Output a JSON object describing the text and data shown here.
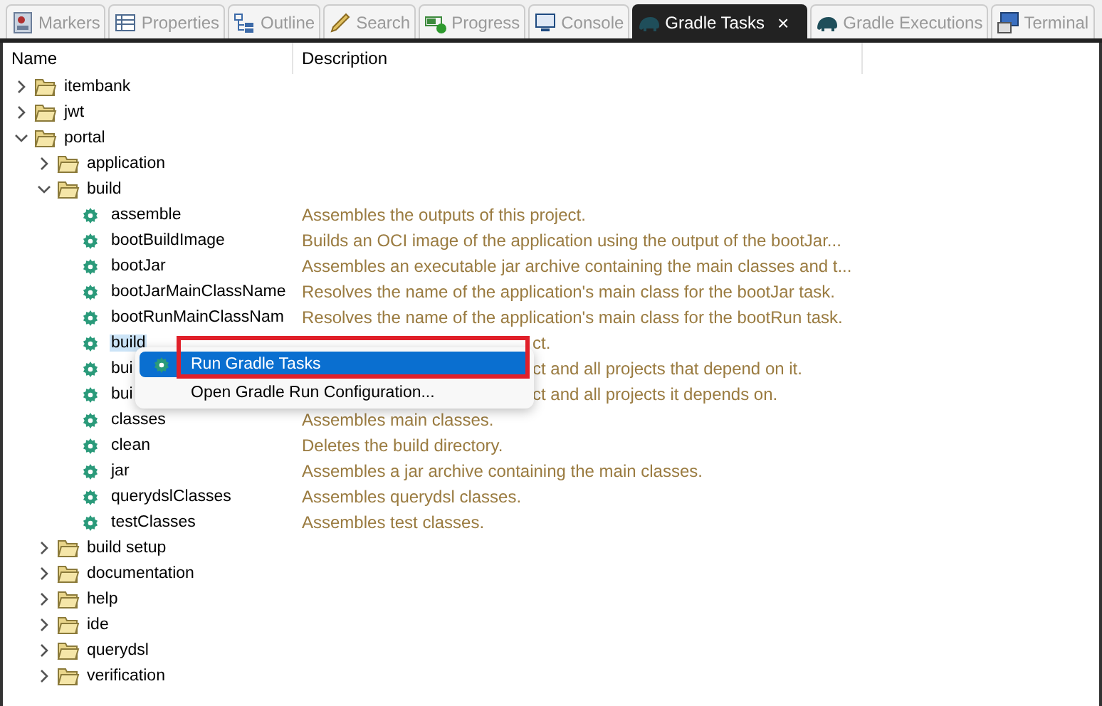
{
  "tabs": [
    {
      "label": "Markers",
      "selected": false
    },
    {
      "label": "Properties",
      "selected": false
    },
    {
      "label": "Outline",
      "selected": false
    },
    {
      "label": "Search",
      "selected": false
    },
    {
      "label": "Progress",
      "selected": false
    },
    {
      "label": "Console",
      "selected": false
    },
    {
      "label": "Gradle Tasks",
      "selected": true,
      "close": "×"
    },
    {
      "label": "Gradle Executions",
      "selected": false
    },
    {
      "label": "Terminal",
      "selected": false
    }
  ],
  "table": {
    "columns": [
      "Name",
      "Description"
    ],
    "rows": [
      {
        "kind": "folder",
        "name": "itembank",
        "expanded": false
      },
      {
        "kind": "folder",
        "name": "jwt",
        "expanded": false
      },
      {
        "kind": "folder",
        "name": "portal",
        "expanded": true,
        "children": [
          {
            "kind": "folder",
            "name": "application",
            "expanded": false
          },
          {
            "kind": "folder",
            "name": "build",
            "expanded": true,
            "children": [
              {
                "kind": "task",
                "name": "assemble",
                "description": "Assembles the outputs of this project.",
                "selected": false
              },
              {
                "kind": "task",
                "name": "bootBuildImage",
                "description": "Builds an OCI image of the application using the output of the bootJar...",
                "selected": false
              },
              {
                "kind": "task",
                "name": "bootJar",
                "description": "Assembles an executable jar archive containing the main classes and t...",
                "selected": false
              },
              {
                "kind": "task",
                "name": "bootJarMainClassName",
                "description": "Resolves the name of the application's main class for the bootJar task.",
                "selected": false
              },
              {
                "kind": "task",
                "name": "bootRunMainClassNam",
                "description": "Resolves the name of the application's main class for the bootRun task.",
                "selected": false
              },
              {
                "kind": "task",
                "name": "build",
                "description": "ct.",
                "covered": true,
                "selected": true
              },
              {
                "kind": "task",
                "name": "bui",
                "description": "ct and all projects that depend on it.",
                "covered": true,
                "selected": false
              },
              {
                "kind": "task",
                "name": "bui",
                "description": "ct and all projects it depends on.",
                "covered": true,
                "selected": false
              },
              {
                "kind": "task",
                "name": "classes",
                "description": "Assembles main classes.",
                "selected": false
              },
              {
                "kind": "task",
                "name": "clean",
                "description": "Deletes the build directory.",
                "selected": false
              },
              {
                "kind": "task",
                "name": "jar",
                "description": "Assembles a jar archive containing the main classes.",
                "selected": false
              },
              {
                "kind": "task",
                "name": "querydslClasses",
                "description": "Assembles querydsl classes.",
                "selected": false
              },
              {
                "kind": "task",
                "name": "testClasses",
                "description": "Assembles test classes.",
                "selected": false
              }
            ]
          },
          {
            "kind": "folder",
            "name": "build setup",
            "expanded": false
          },
          {
            "kind": "folder",
            "name": "documentation",
            "expanded": false
          },
          {
            "kind": "folder",
            "name": "help",
            "expanded": false
          },
          {
            "kind": "folder",
            "name": "ide",
            "expanded": false
          },
          {
            "kind": "folder",
            "name": "querydsl",
            "expanded": false
          },
          {
            "kind": "folder",
            "name": "verification",
            "expanded": false
          }
        ]
      }
    ]
  },
  "context_menu": {
    "items": [
      {
        "label": "Run Gradle Tasks",
        "selected": true,
        "icon": true
      },
      {
        "label": "Open Gradle Run Configuration...",
        "selected": false,
        "icon": false
      }
    ]
  }
}
